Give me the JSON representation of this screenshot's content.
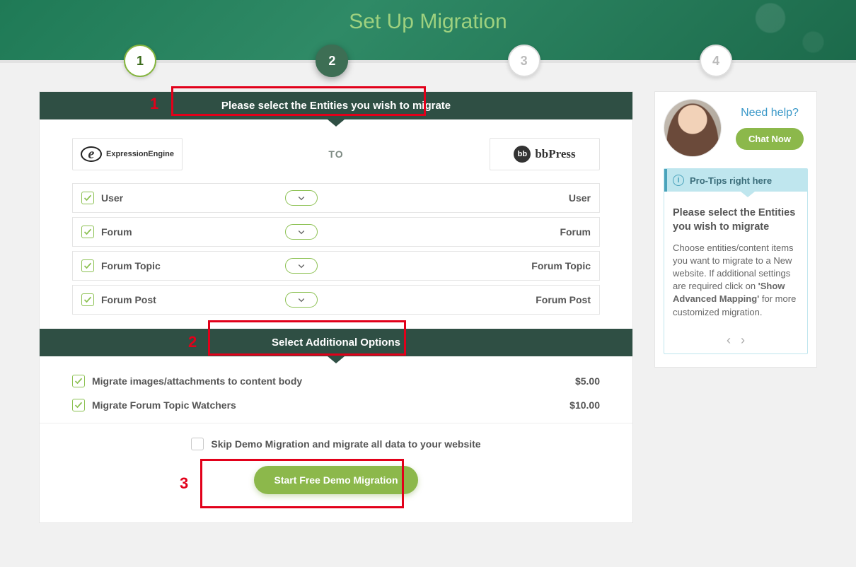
{
  "page": {
    "title": "Set Up Migration"
  },
  "steps": {
    "s1": "1",
    "s2": "2",
    "s3": "3",
    "s4": "4"
  },
  "sections": {
    "entities_header": "Please select the Entities you wish to migrate",
    "options_header": "Select Additional Options"
  },
  "annotations": {
    "n1": "1",
    "n2": "2",
    "n3": "3"
  },
  "logos": {
    "from_mark": "e",
    "from_label": "ExpressionEngine",
    "to_label": "TO",
    "to_mark": "bb",
    "to_text": "bbPress"
  },
  "entities": [
    {
      "source": "User",
      "target": "User",
      "checked": true
    },
    {
      "source": "Forum",
      "target": "Forum",
      "checked": true
    },
    {
      "source": "Forum Topic",
      "target": "Forum Topic",
      "checked": true
    },
    {
      "source": "Forum Post",
      "target": "Forum Post",
      "checked": true
    }
  ],
  "options": [
    {
      "label": "Migrate images/attachments to content body",
      "price": "$5.00",
      "checked": true
    },
    {
      "label": "Migrate Forum Topic Watchers",
      "price": "$10.00",
      "checked": true
    }
  ],
  "skip": {
    "label": "Skip Demo Migration and migrate all data to your website",
    "checked": false
  },
  "cta": {
    "start_demo": "Start Free Demo Migration"
  },
  "sidebar": {
    "need_help": "Need help?",
    "chat_now": "Chat Now",
    "protips_label": "Pro-Tips right here",
    "tip_title": "Please select the Entities you wish to migrate",
    "tip_text_a": "Choose entities/content items you want to migrate to a New website. If additional settings are required click on ",
    "tip_text_b": "'Show Advanced Mapping'",
    "tip_text_c": " for more customized migration."
  }
}
